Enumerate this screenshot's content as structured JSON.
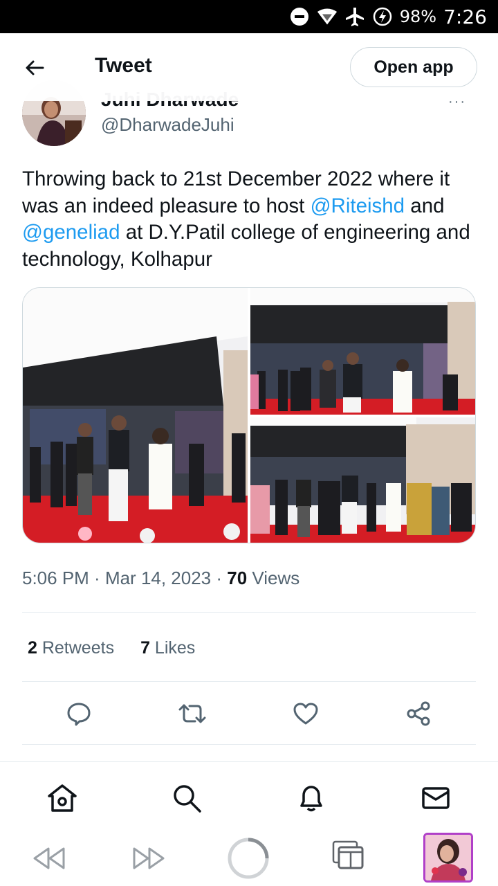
{
  "status_bar": {
    "battery": "98%",
    "time": "7:26",
    "icons": [
      "do-not-disturb-icon",
      "wifi-icon",
      "airplane-mode-icon",
      "battery-charging-icon"
    ]
  },
  "header": {
    "title": "Tweet",
    "open_app_label": "Open app",
    "back_icon": "arrow-left-icon"
  },
  "author": {
    "name": "Juhi Dharwade",
    "handle": "@DharwadeJuhi",
    "more_label": "···"
  },
  "tweet": {
    "text_1": "Throwing back to 21st December 2022 where it was an indeed pleasure to host ",
    "mention_1": "@Riteishd",
    "text_2": " and ",
    "mention_2": "@geneliad",
    "text_3": " at D.Y.Patil college of engineering and technology, Kolhapur"
  },
  "media": {
    "photos": [
      "stage-photo",
      "stage-photo",
      "stage-photo"
    ]
  },
  "meta": {
    "time": "5:06 PM",
    "sep1": " · ",
    "date": "Mar 14, 2023",
    "sep2": " · ",
    "views_count": "70",
    "views_label": " Views"
  },
  "stats": {
    "retweets_count": "2",
    "retweets_label": " Retweets",
    "likes_count": "7",
    "likes_label": " Likes"
  },
  "actions": [
    "reply-icon",
    "retweet-icon",
    "like-icon",
    "share-icon"
  ],
  "bottom_nav": [
    "home-icon",
    "search-icon",
    "notifications-icon",
    "messages-icon"
  ],
  "browser_bar": [
    "rewind-icon",
    "fast-forward-icon",
    "loading-icon",
    "tabs-icon",
    "profile-thumbnail"
  ],
  "colors": {
    "accent": "#1d9bf0",
    "text": "#0f1419",
    "secondary": "#536471",
    "border": "#cfd9de"
  }
}
